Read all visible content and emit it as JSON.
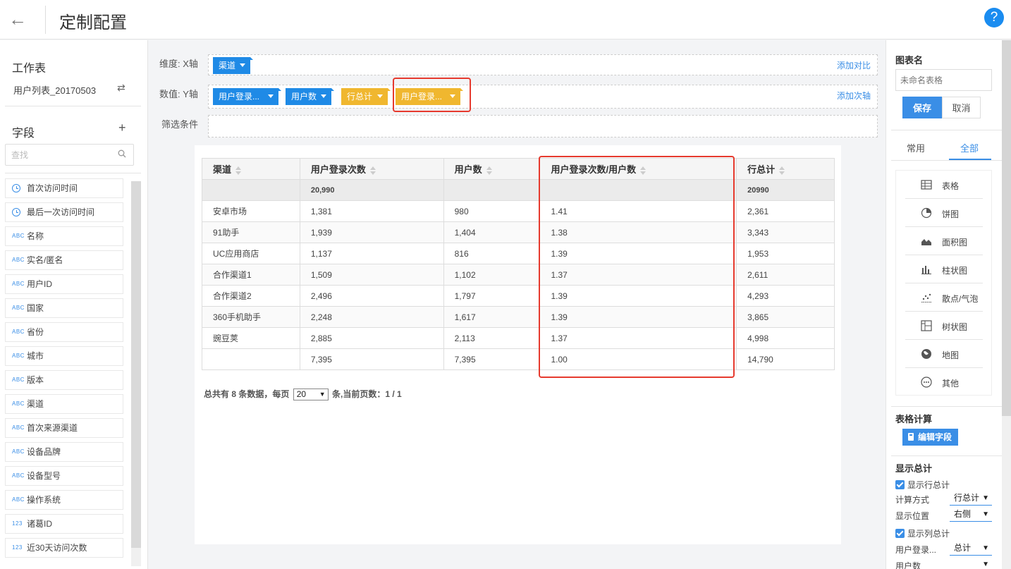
{
  "header": {
    "back_label": "←",
    "title": "定制配置",
    "help_label": "?"
  },
  "left": {
    "worksheet_title": "工作表",
    "worksheet_name": "用户列表_20170503",
    "swap_label": "⇄",
    "fields_title": "字段",
    "add_label": "+",
    "search_placeholder": "查找",
    "fields": [
      {
        "type": "time",
        "type_label": "",
        "name": "首次访问时间"
      },
      {
        "type": "time",
        "type_label": "",
        "name": "最后一次访问时间"
      },
      {
        "type": "text",
        "type_label": "ABC",
        "name": "名称"
      },
      {
        "type": "text",
        "type_label": "ABC",
        "name": "实名/匿名"
      },
      {
        "type": "text",
        "type_label": "ABC",
        "name": "用户ID"
      },
      {
        "type": "text",
        "type_label": "ABC",
        "name": "国家"
      },
      {
        "type": "text",
        "type_label": "ABC",
        "name": "省份"
      },
      {
        "type": "text",
        "type_label": "ABC",
        "name": "城市"
      },
      {
        "type": "text",
        "type_label": "ABC",
        "name": "版本"
      },
      {
        "type": "text",
        "type_label": "ABC",
        "name": "渠道"
      },
      {
        "type": "text",
        "type_label": "ABC",
        "name": "首次来源渠道"
      },
      {
        "type": "text",
        "type_label": "ABC",
        "name": "设备品牌"
      },
      {
        "type": "text",
        "type_label": "ABC",
        "name": "设备型号"
      },
      {
        "type": "text",
        "type_label": "ABC",
        "name": "操作系统"
      },
      {
        "type": "number",
        "type_label": "123",
        "name": "诸葛ID"
      },
      {
        "type": "number",
        "type_label": "123",
        "name": "近30天访问次数"
      }
    ]
  },
  "config": {
    "x_label": "维度: X轴",
    "y_label": "数值: Y轴",
    "filter_label": "筛选条件",
    "x_pills": [
      "渠道"
    ],
    "y_pills": [
      {
        "label": "用户登录...",
        "color": "blue"
      },
      {
        "label": "用户数",
        "color": "blue"
      },
      {
        "label": "行总计",
        "color": "yellow"
      },
      {
        "label": "用户登录...",
        "color": "yellow"
      }
    ],
    "add_compare": "添加对比",
    "add_secondary": "添加次轴"
  },
  "table": {
    "columns": [
      "渠道",
      "用户登录次数",
      "用户数",
      "用户登录次数/用户数",
      "行总计"
    ],
    "total_row": [
      "",
      "20,990",
      "",
      "",
      "20990"
    ],
    "rows": [
      [
        "安卓市场",
        "1,381",
        "980",
        "1.41",
        "2,361"
      ],
      [
        "91助手",
        "1,939",
        "1,404",
        "1.38",
        "3,343"
      ],
      [
        "UC应用商店",
        "1,137",
        "816",
        "1.39",
        "1,953"
      ],
      [
        "合作渠道1",
        "1,509",
        "1,102",
        "1.37",
        "2,611"
      ],
      [
        "合作渠道2",
        "2,496",
        "1,797",
        "1.39",
        "4,293"
      ],
      [
        "360手机助手",
        "2,248",
        "1,617",
        "1.39",
        "3,865"
      ],
      [
        "豌豆荚",
        "2,885",
        "2,113",
        "1.37",
        "4,998"
      ],
      [
        "",
        "7,395",
        "7,395",
        "1.00",
        "14,790"
      ]
    ],
    "pager": {
      "prefix": "总共有 8 条数据，每页",
      "page_size": "20",
      "suffix": "条,当前页数：1 / 1"
    }
  },
  "right": {
    "chart_name_title": "图表名",
    "chart_name_placeholder": "未命名表格",
    "save_label": "保存",
    "cancel_label": "取消",
    "tabs": [
      "常用",
      "全部"
    ],
    "chart_types": [
      {
        "icon": "table-icon",
        "label": "表格"
      },
      {
        "icon": "pie-icon",
        "label": "饼图"
      },
      {
        "icon": "area-icon",
        "label": "面积图"
      },
      {
        "icon": "bar-icon",
        "label": "柱状图"
      },
      {
        "icon": "scatter-icon",
        "label": "散点/气泡"
      },
      {
        "icon": "tree-icon",
        "label": "树状图"
      },
      {
        "icon": "map-icon",
        "label": "地图"
      },
      {
        "icon": "more-icon",
        "label": "其他"
      }
    ],
    "calc_title": "表格计算",
    "edit_field_label": "编辑字段",
    "totals_title": "显示总计",
    "show_row_total": "显示行总计",
    "calc_method_label": "计算方式",
    "calc_method_value": "行总计",
    "position_label": "显示位置",
    "position_value": "右侧",
    "show_col_total": "显示列总计",
    "col_field_1": "用户登录...",
    "col_field_1_value": "总计",
    "col_field_2": "用户数"
  },
  "colors": {
    "accent": "#3a8ee6",
    "pill_blue": "#1f8ae6",
    "pill_yellow": "#f0b72f",
    "highlight_red": "#e63a2e"
  }
}
